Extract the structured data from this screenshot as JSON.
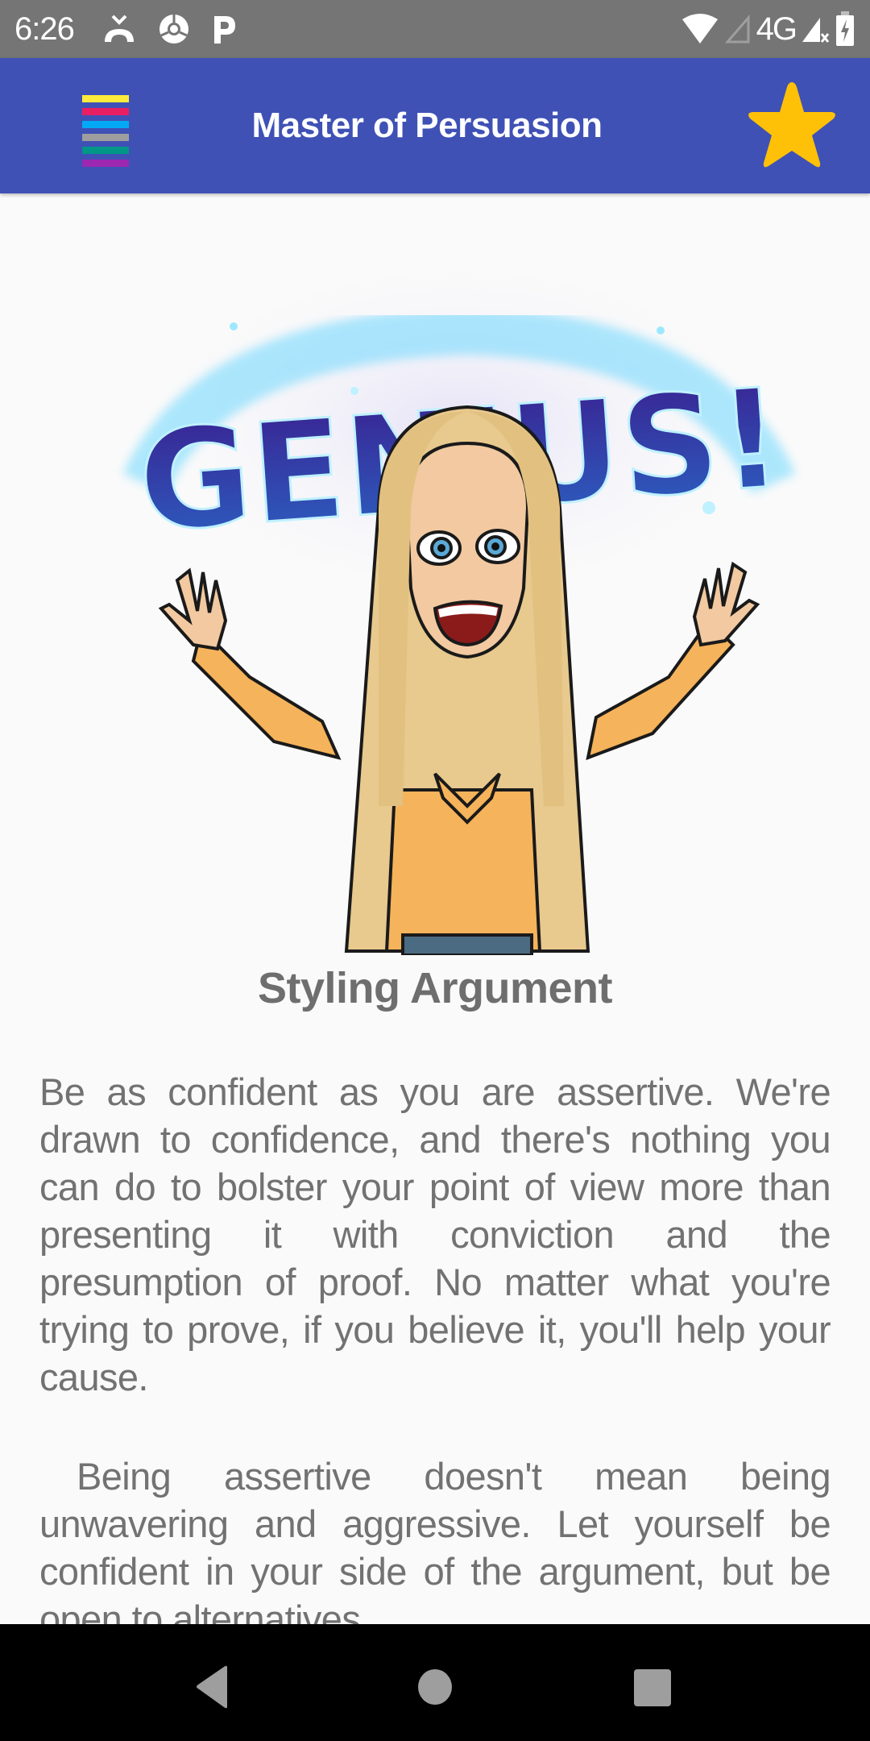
{
  "status_bar": {
    "time": "6:26",
    "left_icons": [
      "missed-call-icon",
      "chrome-icon",
      "parking-app-icon"
    ],
    "network": "4G",
    "right_icons": [
      "wifi-icon",
      "signal-empty-icon",
      "signal-no-data-icon",
      "battery-charging-icon"
    ]
  },
  "app_bar": {
    "title": "Master of Persuasion",
    "menu_icon": "multicolor-menu-icon",
    "menu_colors": [
      "#ffeb3b",
      "#e91e63",
      "#03a9f4",
      "#9e9e9e",
      "#009688",
      "#9c27b0"
    ],
    "favorite_icon": "star-icon",
    "star_color": "#ffc107",
    "bar_color": "#3f51b5"
  },
  "content": {
    "hero_image": {
      "alt": "Bitmoji woman with raised arms under a glowing 'GENIUS!' banner",
      "banner_text": "GENIUS!"
    },
    "section_title": "Styling Argument",
    "paragraphs": [
      "Be as confident as you are assertive. We're drawn to confidence, and there's nothing you can do to bolster your point of view more than presenting it with conviction and the presumption of proof. No matter what you're trying to prove, if you believe it, you'll help your cause.",
      "Being assertive doesn't mean being unwavering and aggressive. Let yourself be confident in your side of the argument, but be open to alternatives."
    ]
  },
  "nav_bar": {
    "back": "back-icon",
    "home": "home-icon",
    "recents": "recents-icon"
  }
}
